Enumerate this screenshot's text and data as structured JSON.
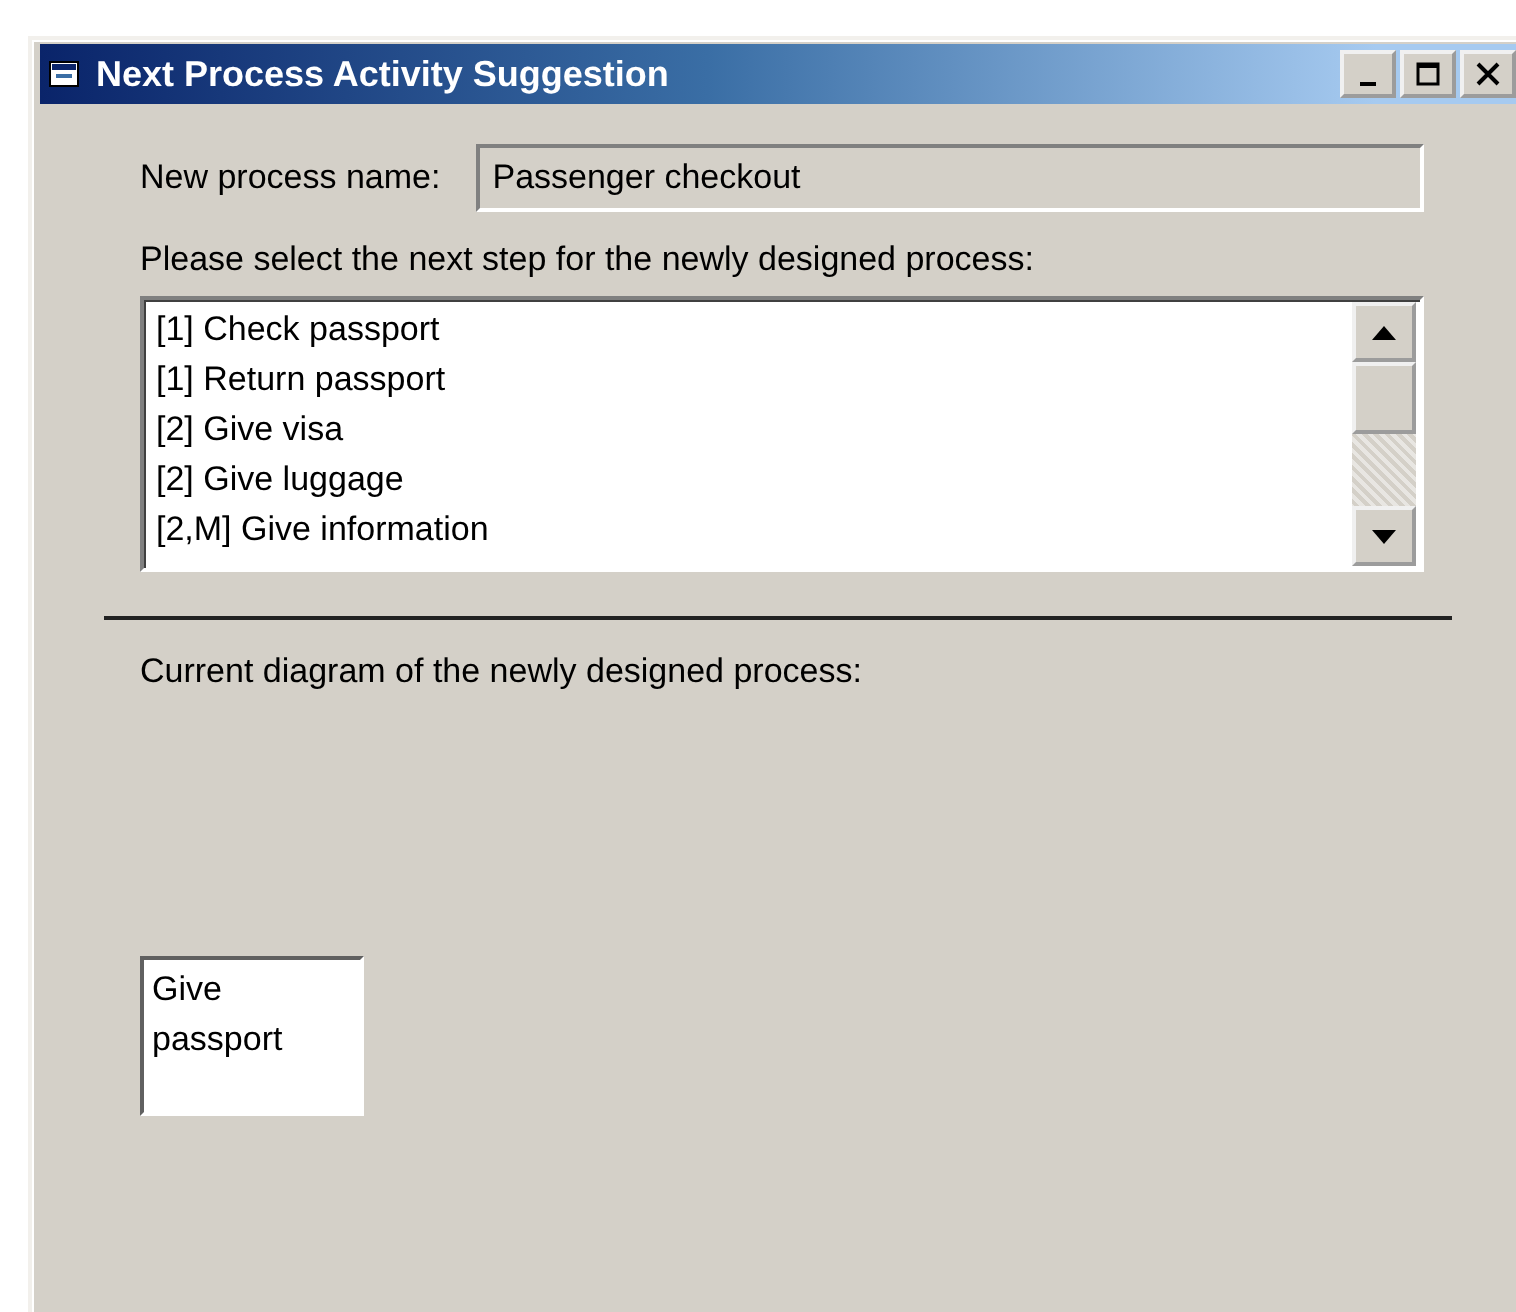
{
  "window": {
    "title": "Next Process Activity Suggestion"
  },
  "process_name": {
    "label": "New process name:",
    "value": "Passenger checkout"
  },
  "next_step": {
    "label": "Please select the next step for the newly designed process:",
    "items": [
      {
        "label": "[1] Check passport"
      },
      {
        "label": "[1] Return passport"
      },
      {
        "label": "[2] Give visa"
      },
      {
        "label": "[2] Give luggage"
      },
      {
        "label": "[2,M] Give information"
      }
    ]
  },
  "diagram": {
    "label": "Current diagram of the newly designed process:",
    "nodes": [
      {
        "label": "Give passport"
      }
    ]
  }
}
